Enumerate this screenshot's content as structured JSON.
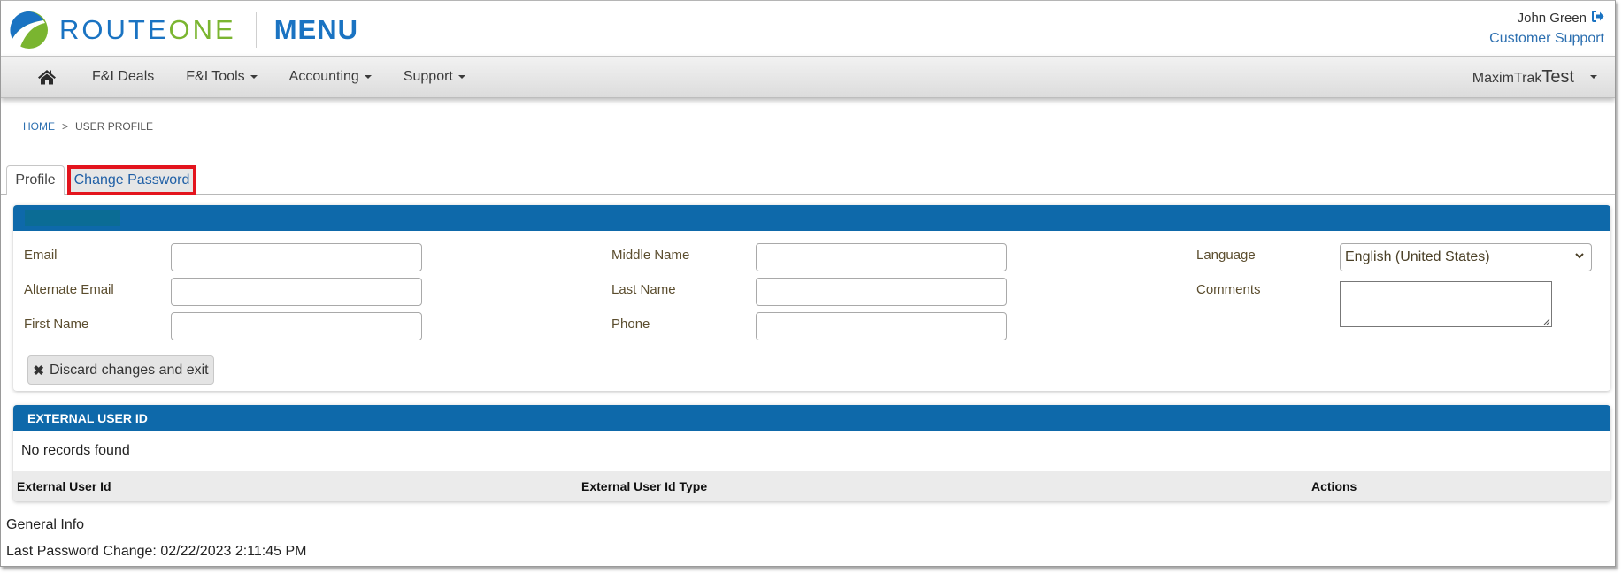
{
  "header": {
    "logo_route": "ROUTE",
    "logo_one": "ONE",
    "logo_menu": "MENU",
    "user_name": "John Green",
    "logout_icon": "sign-out-icon",
    "support_link": "Customer Support"
  },
  "nav": {
    "home_icon": "home-icon",
    "items": [
      {
        "label": "F&I Deals",
        "has_dropdown": false
      },
      {
        "label": "F&I Tools",
        "has_dropdown": true
      },
      {
        "label": "Accounting",
        "has_dropdown": true
      },
      {
        "label": "Support",
        "has_dropdown": true
      }
    ],
    "account_name": "MaximTrak",
    "account_suffix": "Test"
  },
  "breadcrumb": {
    "home": "HOME",
    "separator": ">",
    "current": "USER PROFILE"
  },
  "tabs": [
    {
      "label": "Profile",
      "active": true
    },
    {
      "label": "Change Password",
      "active": false,
      "highlighted": true
    }
  ],
  "profile_panel": {
    "header": "",
    "fields": {
      "email": {
        "label": "Email",
        "value": ""
      },
      "alternate_email": {
        "label": "Alternate Email",
        "value": ""
      },
      "first_name": {
        "label": "First Name",
        "value": ""
      },
      "middle_name": {
        "label": "Middle Name",
        "value": ""
      },
      "last_name": {
        "label": "Last Name",
        "value": ""
      },
      "phone": {
        "label": "Phone",
        "value": ""
      },
      "language": {
        "label": "Language",
        "value": "English (United States)"
      },
      "comments": {
        "label": "Comments",
        "value": ""
      }
    },
    "discard_button": "Discard changes and exit"
  },
  "external_panel": {
    "header": "EXTERNAL USER ID",
    "empty_message": "No records found",
    "columns": [
      "External User Id",
      "External User Id Type",
      "Actions"
    ]
  },
  "general_info": {
    "title": "General Info",
    "last_password_change_label": "Last Password Change:",
    "last_password_change_value": "02/22/2023 2:11:45 PM",
    "last_password_change": "Last Password Change: 02/22/2023 2:11:45 PM"
  },
  "colors": {
    "brand_blue": "#1a73c2",
    "brand_green": "#7ab530",
    "panel_header": "#0e69aa",
    "highlight_red": "#e3141d",
    "link_blue": "#2c6fb0"
  }
}
